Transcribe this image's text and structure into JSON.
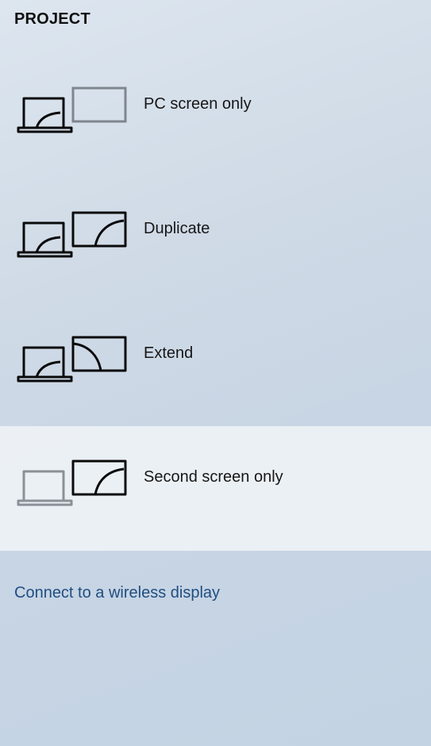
{
  "panel": {
    "title": "PROJECT"
  },
  "options": [
    {
      "label": "PC screen only",
      "icon": "pc-screen-only-icon",
      "selected": false
    },
    {
      "label": "Duplicate",
      "icon": "duplicate-icon",
      "selected": false
    },
    {
      "label": "Extend",
      "icon": "extend-icon",
      "selected": false
    },
    {
      "label": "Second screen only",
      "icon": "second-screen-only-icon",
      "selected": true
    }
  ],
  "connect": {
    "label": "Connect to a wireless display"
  },
  "colors": {
    "selected_background": "#f2f4f7",
    "link": "#1f4e80",
    "icon_active": "#0a0a0a",
    "icon_muted": "#8a9096"
  }
}
